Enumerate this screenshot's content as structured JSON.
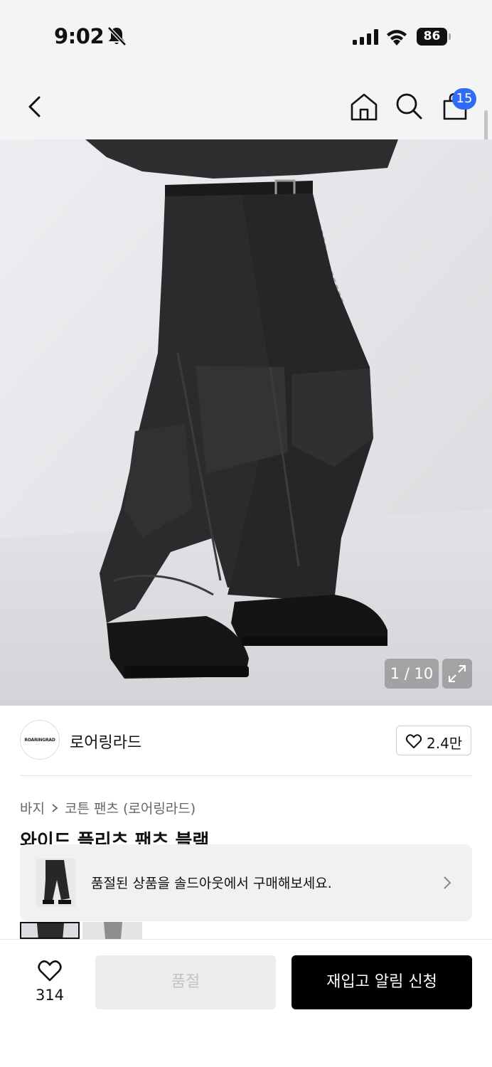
{
  "status_bar": {
    "time": "9:02",
    "battery": "86",
    "icons": [
      "bell-slash-icon",
      "cellular-signal-icon",
      "wifi-icon",
      "battery-icon"
    ]
  },
  "nav": {
    "icons": [
      "chevron-left-icon",
      "home-icon",
      "search-icon",
      "shopping-bag-icon"
    ],
    "cart_count": "15"
  },
  "gallery": {
    "counter": "1 / 10",
    "expand_icon": "expand-icon"
  },
  "brand": {
    "logo_text": "ROARINGRAD",
    "name": "로어링라드",
    "like_count": "2.4만"
  },
  "breadcrumb": {
    "category": "바지",
    "subcategory": "코튼 팬츠 (로어링라드)"
  },
  "product": {
    "title_partial": "와이드 플리츠 팬츠 블랙"
  },
  "soldout_banner": {
    "text": "품절된 상품을 솔드아웃에서 구매해보세요."
  },
  "bottom_bar": {
    "wish_count": "314",
    "soldout_label": "품절",
    "restock_label": "재입고 알림 신청"
  },
  "colors": {
    "accent_badge": "#2f6bf4",
    "primary_button": "#000000",
    "disabled_button": "#ececec"
  }
}
